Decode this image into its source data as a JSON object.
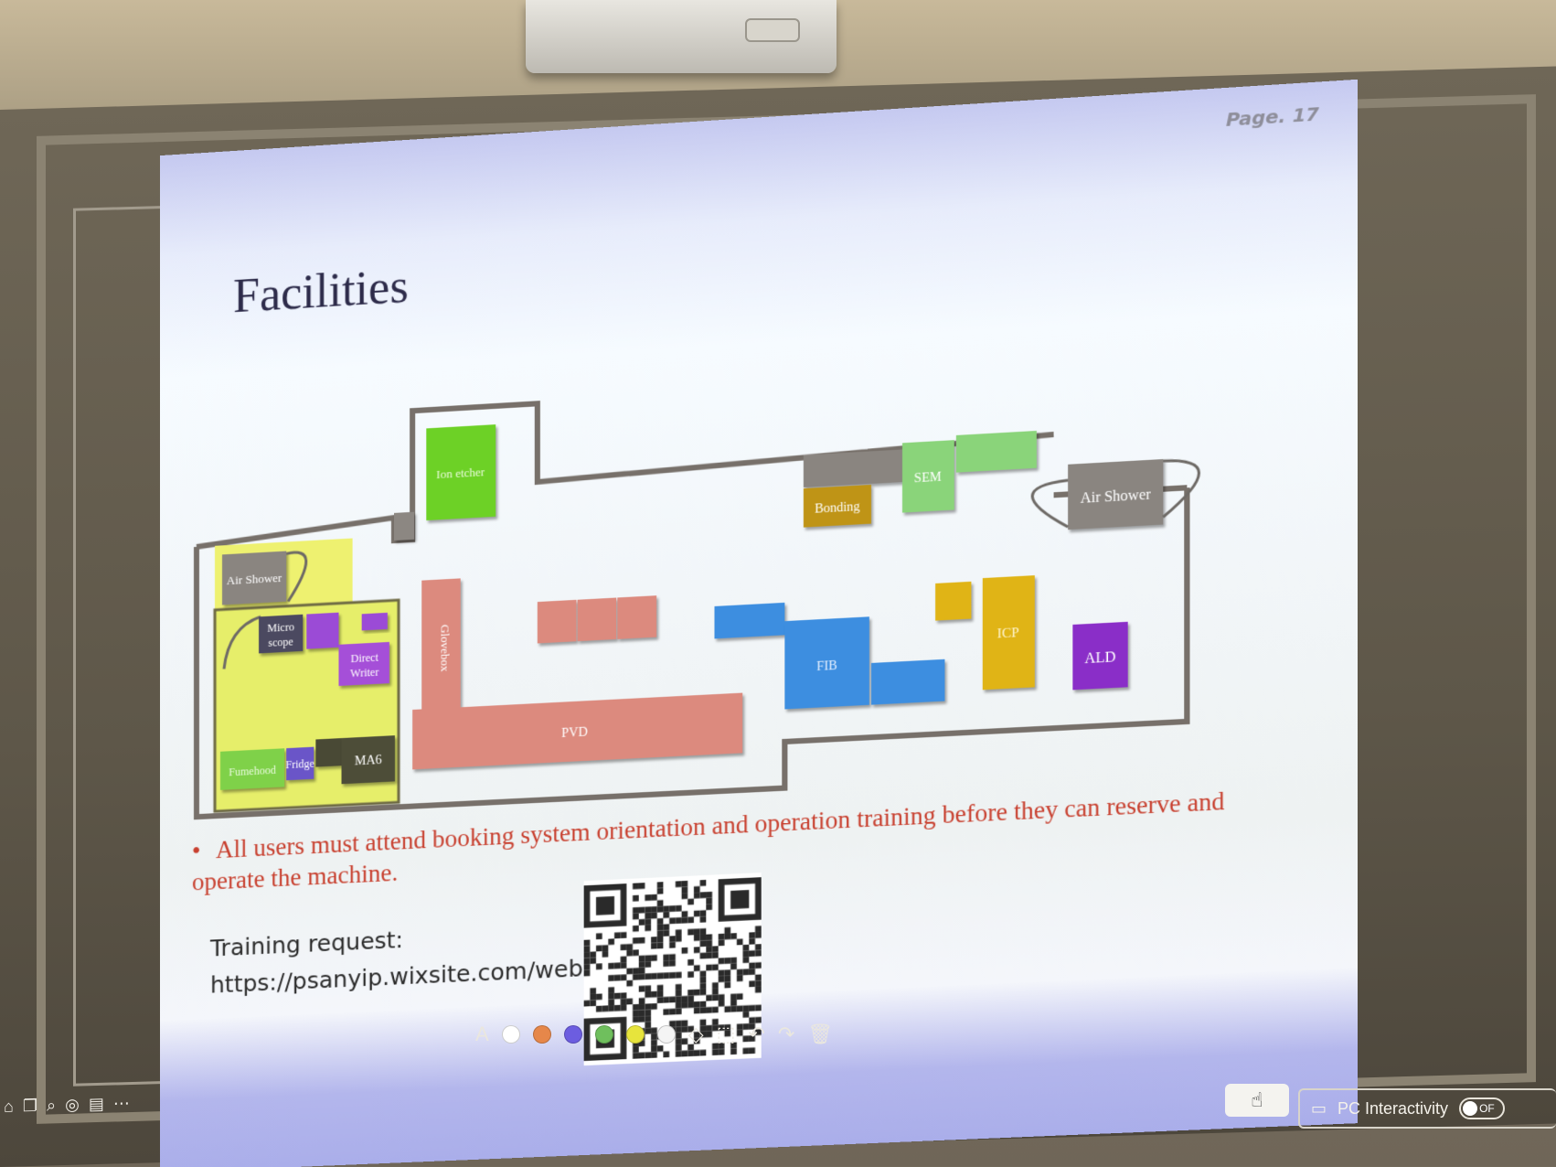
{
  "slide": {
    "page": "Page. 17",
    "title": "Facilities",
    "bullet": "All users must attend booking system orientation and operation training before they can reserve and operate the machine.",
    "training_label": "Training request:",
    "training_url": "https://psanyip.wixsite.com/website"
  },
  "floorplan": {
    "ion_etcher": "Ion etcher",
    "sem": "SEM",
    "bonding": "Bonding",
    "air_shower_right": "Air Shower",
    "air_shower_left": "Air Shower",
    "microscope_line1": "Micro",
    "microscope_line2": "scope",
    "direct_writer_line1": "Direct",
    "direct_writer_line2": "Writer",
    "glovebox": "Glovebox",
    "pvd": "PVD",
    "fib": "FIB",
    "icp": "ICP",
    "ald": "ALD",
    "fumehood": "Fumehood",
    "fridge": "Fridge",
    "ma6": "MA6"
  },
  "toolbar": {
    "colors": [
      "#ffffff",
      "#e6874a",
      "#6c5de0",
      "#6fbf5d",
      "#e7e43c",
      "#f4f4f4"
    ],
    "pen_icon": "A",
    "eraser_icon": "eraser-icon",
    "select_icon": "selection-icon",
    "undo_icon": "undo-icon",
    "redo_icon": "redo-icon",
    "trash_icon": "trash-icon"
  },
  "controls": {
    "pc_interactivity_label": "PC Interactivity",
    "toggle_label": "OF"
  }
}
